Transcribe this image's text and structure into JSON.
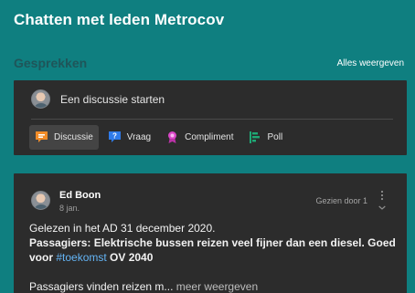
{
  "header": {
    "title": "Chatten met leden Metrocov"
  },
  "conversations": {
    "title": "Gesprekken",
    "see_all_label": "Alles weergeven"
  },
  "composer": {
    "start_discussion_label": "Een discussie starten",
    "post_types": [
      {
        "label": "Discussie",
        "icon": "discussion-icon",
        "color": "#f28c28"
      },
      {
        "label": "Vraag",
        "icon": "question-icon",
        "color": "#2f7bea"
      },
      {
        "label": "Compliment",
        "icon": "award-icon",
        "color": "#d946c7"
      },
      {
        "label": "Poll",
        "icon": "poll-icon",
        "color": "#1ea875"
      }
    ]
  },
  "post": {
    "author": "Ed Boon",
    "date": "8 jan.",
    "seen_by": "Gezien door 1",
    "intro": "Gelezen in het AD 31 december 2020.",
    "headline_part1": "Passagiers: Elektrische bussen reizen veel fijner dan een diesel. Goed voor ",
    "hashtag": "#toekomst",
    "headline_part2": " OV 2040",
    "preview": "Passagiers vinden reizen m...",
    "more_label": "meer weergeven"
  }
}
